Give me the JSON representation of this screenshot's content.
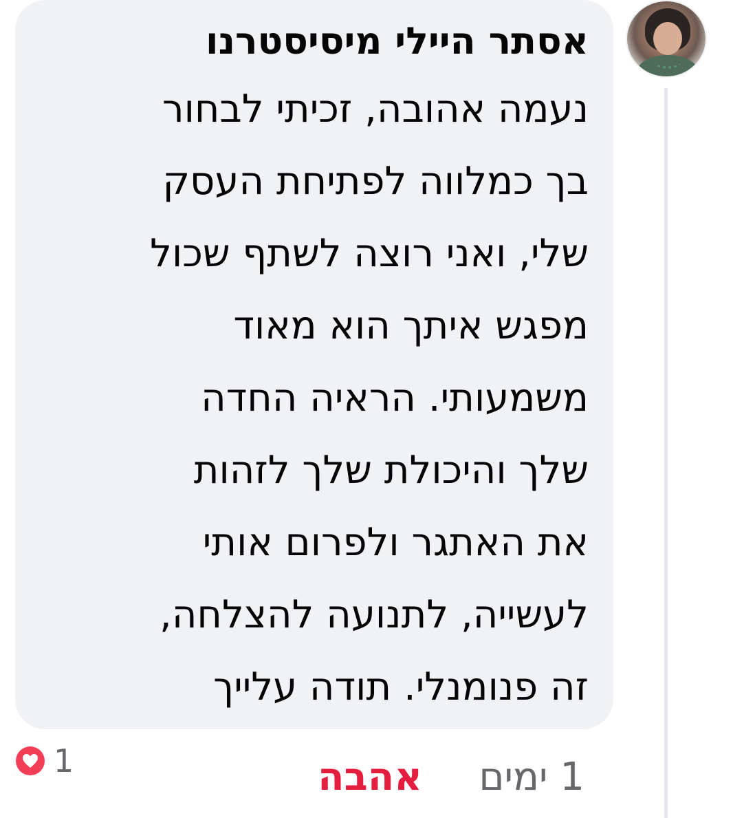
{
  "comment": {
    "author_name": "אסתר היילי מיסיסטרנו",
    "body_lines": [
      "נעמה אהובה, זכיתי לבחור",
      "בך כמלווה לפתיחת העסק",
      "שלי, ואני רוצה לשתף שכול",
      "מפגש איתך הוא מאוד",
      "משמעותי. הראיה החדה",
      "שלך והיכולת שלך לזהות",
      "את האתגר ולפרום אותי",
      "לעשייה, לתנועה להצלחה,",
      "זה פנומנלי. תודה עלייך"
    ],
    "avatar_icon": "profile-photo",
    "bubble_color": "#f0f2f5"
  },
  "footer": {
    "time_label": "1 ימים",
    "reaction_link_label": "אהבה",
    "reaction_link_color": "#e41e3f",
    "reaction_count": "1",
    "reaction_icon": "heart-icon",
    "reaction_color": "#f33e58"
  }
}
